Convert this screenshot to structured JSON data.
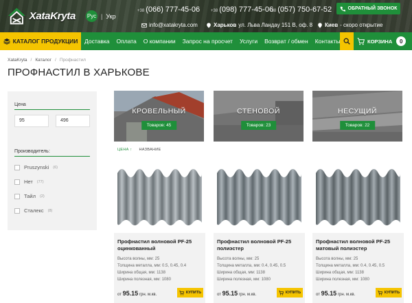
{
  "header": {
    "logo_text": "XataKryta",
    "lang_active": "Рус",
    "lang_other": "Укр",
    "phones": [
      {
        "code": "+38",
        "number": "(066) 777-45-06"
      },
      {
        "code": "+38",
        "number": "(098) 777-45-06"
      },
      {
        "code": "+38",
        "number": "(057) 750-67-52"
      }
    ],
    "email": "info@xatakryta.com",
    "address_city": "Харьков",
    "address_street": "ул. Льва Ландау 151 В, оф. 8",
    "kiev_city": "Киев",
    "kiev_note": "- скоро открытие",
    "callback_label": "ОБРАТНЫЙ ЗВОНОК"
  },
  "nav": {
    "catalog_label": "КАТАЛОГ ПРОДУКЦИИ",
    "items": [
      "Доставка",
      "Оплата",
      "О компании",
      "Запрос на просчет",
      "Услуги",
      "Возврат / обмен",
      "Контакты"
    ],
    "cart_label": "КОРЗИНА",
    "cart_count": "0"
  },
  "breadcrumb": {
    "items": [
      "XataKryta",
      "Каталог",
      "Профнастил"
    ]
  },
  "page_title": "ПРОФНАСТИЛ В ХАРЬКОВЕ",
  "filter": {
    "price_label": "Цена",
    "price_min": "95",
    "price_max": "496",
    "maker_label": "Производитель:",
    "brands": [
      {
        "name": "Pruszynski",
        "count": "(6)"
      },
      {
        "name": "Нет",
        "count": "(77)"
      },
      {
        "name": "Тайл",
        "count": "(2)"
      },
      {
        "name": "Сталекс",
        "count": "(8)"
      }
    ]
  },
  "categories": [
    {
      "title": "КРОВЕЛЬНЫЙ",
      "count": "Товаров: 45"
    },
    {
      "title": "СТЕНОВОЙ",
      "count": "Товаров: 23"
    },
    {
      "title": "НЕСУЩИЙ",
      "count": "Товаров: 22"
    }
  ],
  "sort": {
    "active": "ЦЕНА ↑",
    "other": "НАЗВАНИЕ"
  },
  "products": [
    {
      "name": "Профнастил волновой PF-25 оцинкованный",
      "specs": [
        "Высота волны, мм: 25",
        "Толщина металла, мм: 0.5, 0.45, 0.4",
        "Ширина общая, мм: 1138",
        "Ширина полезная, мм: 1080"
      ],
      "price_prefix": "от",
      "price": "95.15",
      "unit": "грн. м.кв.",
      "buy_label": "КУПИТЬ"
    },
    {
      "name": "Профнастил волновой PF-25 полиэстер",
      "specs": [
        "Высота волны, мм: 25",
        "Толщина металла, мм: 0.4, 0.45, 0.5",
        "Ширина общая, мм: 1138",
        "Ширина полезная, мм: 1080"
      ],
      "price_prefix": "от",
      "price": "95.15",
      "unit": "грн. м.кв.",
      "buy_label": "КУПИТЬ"
    },
    {
      "name": "Профнастил волновой PF-25 матовый полиэстер",
      "specs": [
        "Высота волны, мм: 25",
        "Толщина металла, мм: 0.4, 0.45, 0.5",
        "Ширина общая, мм: 1138",
        "Ширина полезная, мм: 1080"
      ],
      "price_prefix": "от",
      "price": "95.15",
      "unit": "грн. м.кв.",
      "buy_label": "КУПИТЬ"
    }
  ],
  "colors": {
    "brand_green": "#1f8f3a",
    "accent_yellow": "#f5c400"
  }
}
